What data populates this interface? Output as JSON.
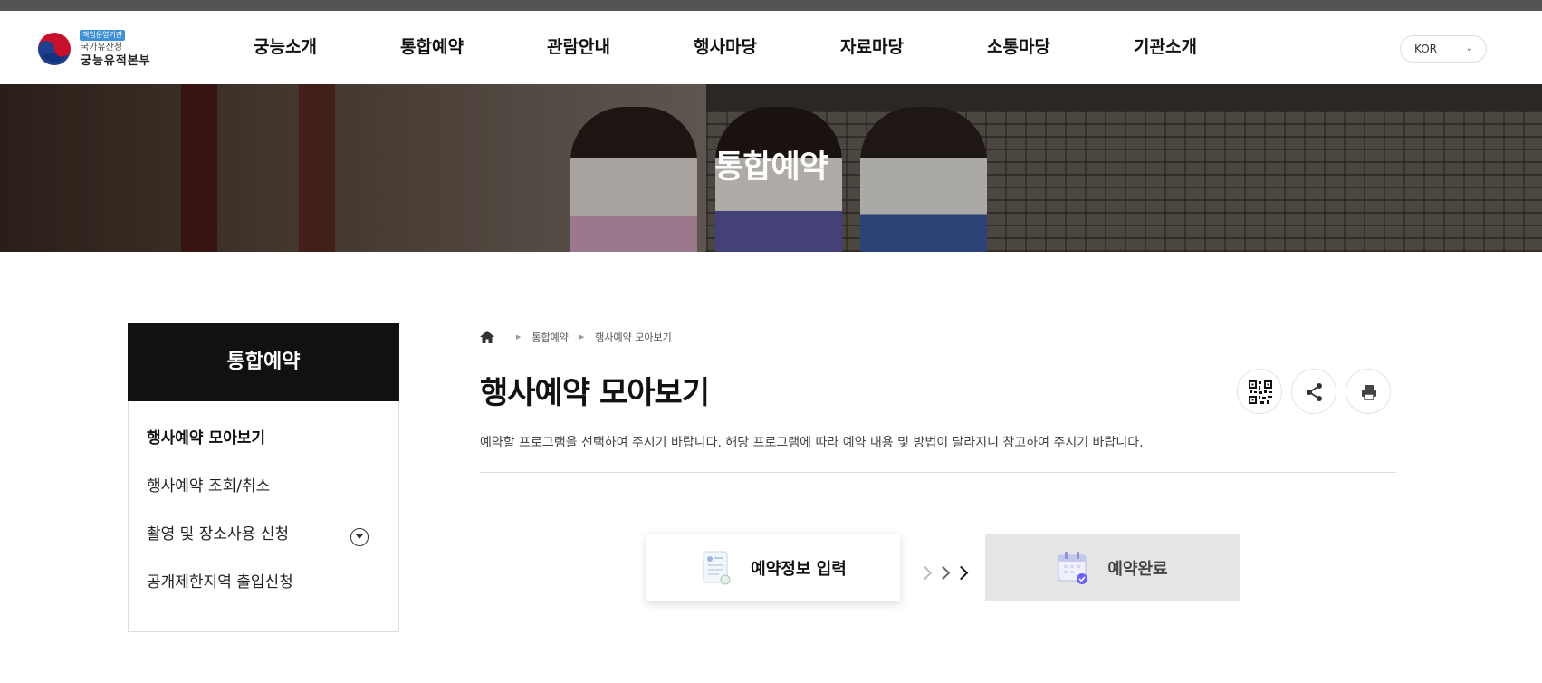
{
  "header": {
    "logo": {
      "badge": "책임운영기관",
      "sub": "국가유산청",
      "main": "궁능유적본부"
    },
    "nav": [
      "궁능소개",
      "통합예약",
      "관람안내",
      "행사마당",
      "자료마당",
      "소통마당",
      "기관소개"
    ],
    "language": "KOR"
  },
  "hero": {
    "title": "통합예약"
  },
  "sidebar": {
    "title": "통합예약",
    "items": [
      {
        "label": "행사예약 모아보기",
        "active": true
      },
      {
        "label": "행사예약 조회/취소",
        "active": false
      },
      {
        "label": "촬영 및 장소사용 신청",
        "active": false,
        "expandable": true
      },
      {
        "label": "공개제한지역 출입신청",
        "active": false
      }
    ]
  },
  "breadcrumb": [
    "통합예약",
    "행사예약 모아보기"
  ],
  "main": {
    "title": "행사예약 모아보기",
    "description": "예약할 프로그램을 선택하여 주시기 바랍니다. 해당 프로그램에 따라 예약 내용 및 방법이 달라지니 참고하여 주시기 바랍니다.",
    "tools": [
      "qr-code-icon",
      "share-icon",
      "print-icon"
    ]
  },
  "steps": [
    {
      "label": "예약정보 입력",
      "state": "current"
    },
    {
      "label": "예약완료",
      "state": "pending"
    }
  ],
  "colors": {
    "sidebar_head": "#111111",
    "step_pending_bg": "#e5e5e5",
    "accent_blue": "#3d8fd8",
    "calendar_purple": "#6c63ff"
  }
}
